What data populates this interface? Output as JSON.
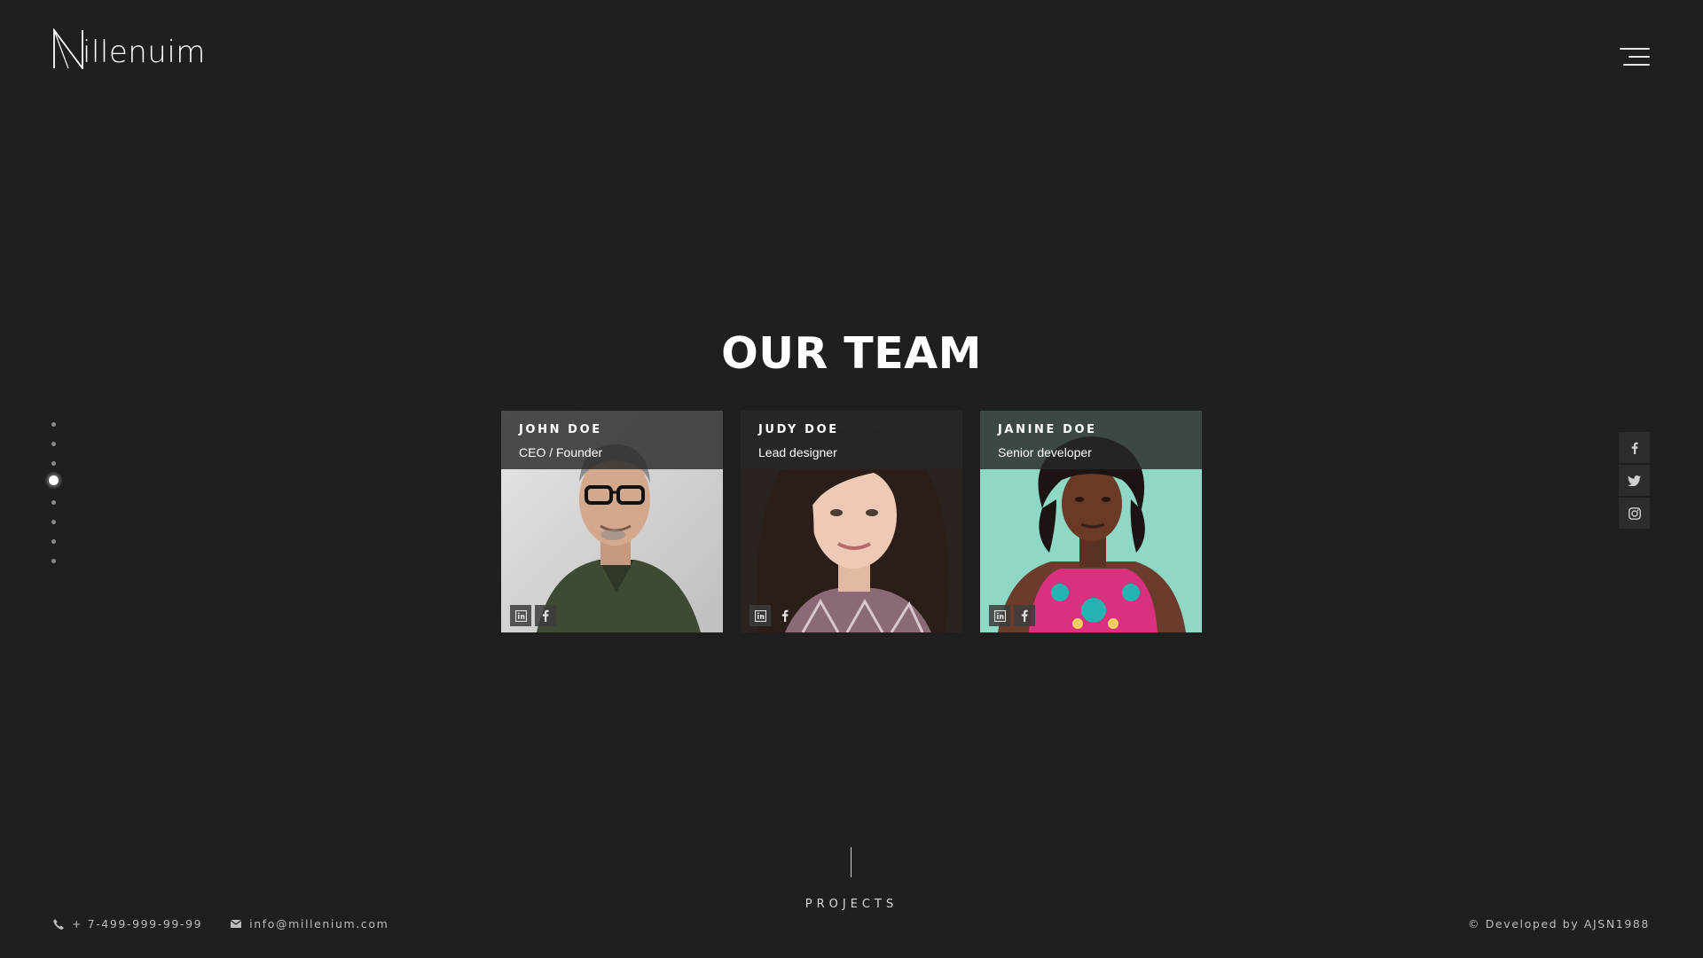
{
  "header": {
    "logo_text": "illenuim",
    "logo_mark": "M",
    "menu_icon": "hamburger-icon"
  },
  "dot_nav": {
    "count": 8,
    "active_index": 3
  },
  "team": {
    "title": "OUR TEAM",
    "members": [
      {
        "name": "JOHN DOE",
        "role": "CEO / Founder",
        "socials": [
          "linkedin-icon",
          "facebook-icon"
        ]
      },
      {
        "name": "JUDY DOE",
        "role": "Lead designer",
        "socials": [
          "linkedin-icon",
          "facebook-icon"
        ]
      },
      {
        "name": "JANINE DOE",
        "role": "Senior developer",
        "socials": [
          "linkedin-icon",
          "facebook-icon"
        ]
      }
    ]
  },
  "side_social": [
    "facebook-icon",
    "twitter-icon",
    "instagram-icon"
  ],
  "next_section": {
    "label": "PROJECTS"
  },
  "footer": {
    "phone": "+ 7-499-999-99-99",
    "email": "info@millenium.com",
    "copyright": "© Developed by AJSN1988"
  },
  "colors": {
    "background": "#1f1f1f",
    "card_header": "#282828",
    "text": "#ffffff",
    "muted": "#bdbdbd"
  }
}
